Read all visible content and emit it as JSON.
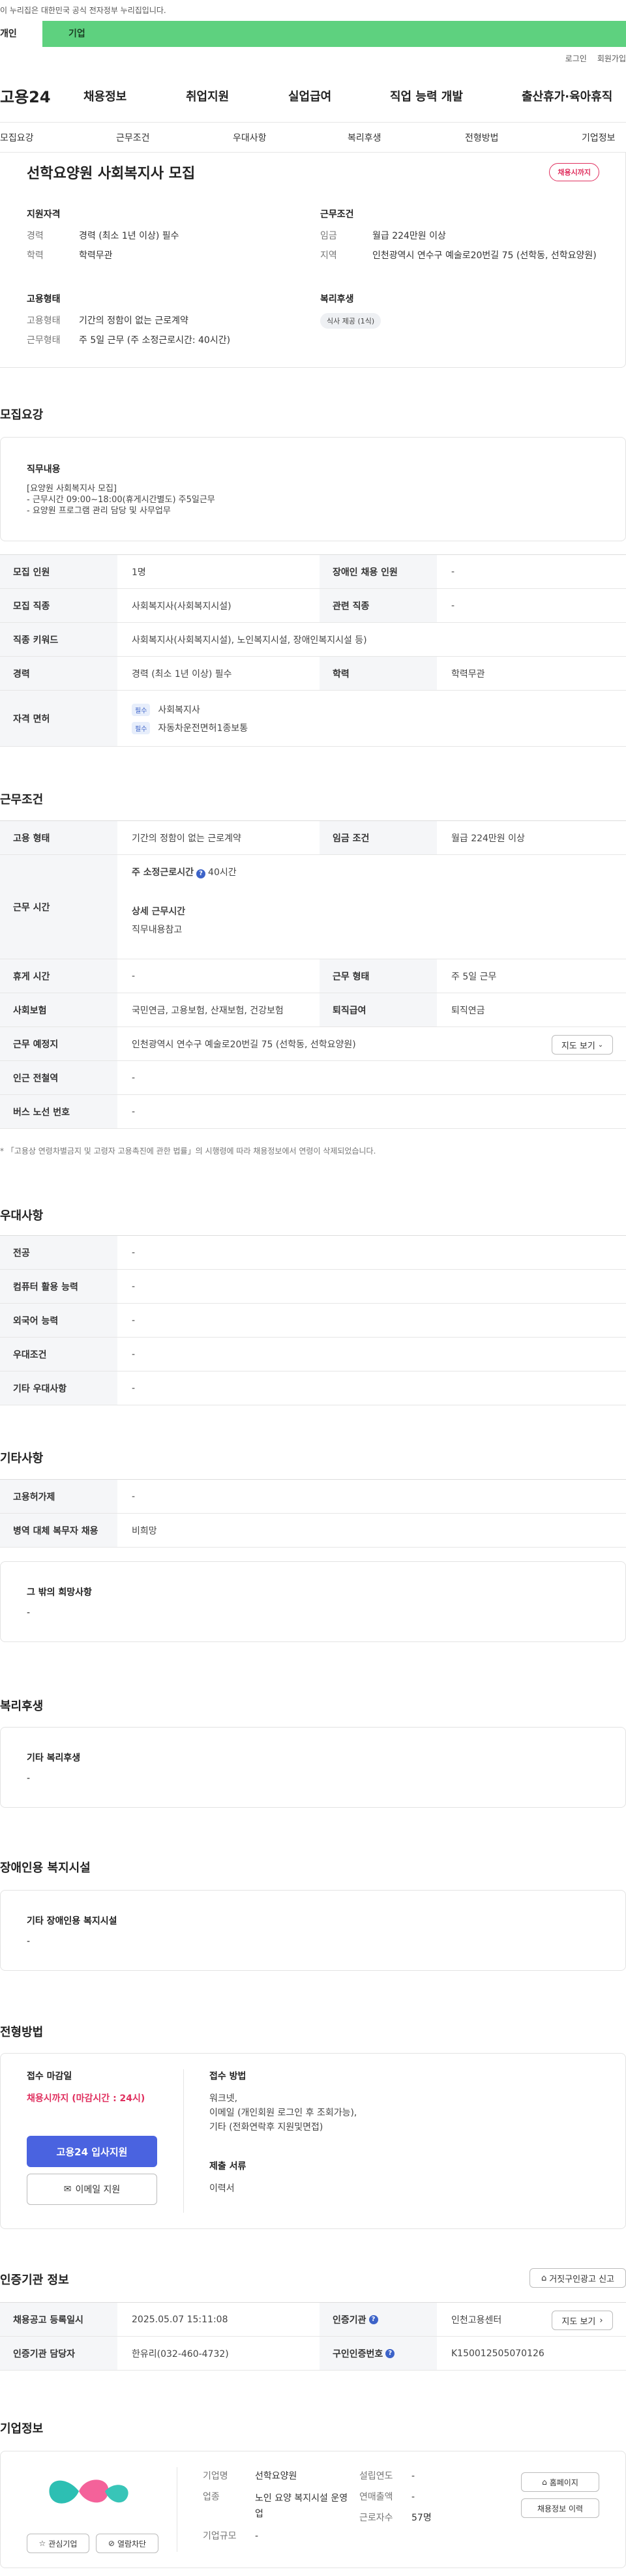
{
  "gov_banner": "이 누리집은 대한민국 공식 전자정부 누리집입니다.",
  "top_tabs": [
    "개인",
    "기업"
  ],
  "util": [
    "로그인",
    "회원가입"
  ],
  "gnb": {
    "logo": "고용24",
    "items": [
      "채용정보",
      "취업지원",
      "실업급여",
      "직업 능력 개발",
      "출산휴가·육아휴직"
    ]
  },
  "subnav": [
    "모집요강",
    "근무조건",
    "우대사항",
    "복리후생",
    "전형방법",
    "기업정보"
  ],
  "summary": {
    "title": "선학요양원 사회복지사 모집",
    "badge": "채용시까지",
    "qual_h": "지원자격",
    "qual": [
      {
        "k": "경력",
        "v": "경력 (최소 1년 이상) 필수"
      },
      {
        "k": "학력",
        "v": "학력무관"
      }
    ],
    "work_h": "근무조건",
    "work": [
      {
        "k": "임금",
        "v": "월급 224만원 이상"
      },
      {
        "k": "지역",
        "v": "인천광역시 연수구 예술로20번길 75 (선학동, 선학요양원)"
      }
    ],
    "emp_h": "고용형태",
    "emp": [
      {
        "k": "고용형태",
        "v": "기간의 정함이 없는 근로계약"
      },
      {
        "k": "근무형태",
        "v": "주 5일 근무 (주 소정근로시간: 40시간)"
      }
    ],
    "welfare_h": "복리후생",
    "welfare_chip": "식사 제공 (1식)"
  },
  "recruit": {
    "heading": "모집요강",
    "duty_h": "직무내용",
    "duty_lines": [
      "[요양원 사회복지사 모집]",
      "- 근무시간 09:00~18:00(휴게시간별도) 주5일근무",
      "- 요양원 프로그램 관리 담당 및 사무업무"
    ],
    "rows": [
      {
        "k1": "모집 인원",
        "v1": "1명",
        "k2": "장애인 채용 인원",
        "v2": "-"
      },
      {
        "k1": "모집 직종",
        "v1": "사회복지사(사회복지시설)",
        "k2": "관련 직종",
        "v2": "-"
      },
      {
        "k1": "직종 키워드",
        "v1": "사회복지사(사회복지시설), 노인복지시설, 장애인복지시설 등)"
      },
      {
        "k1": "경력",
        "v1": "경력 (최소 1년 이상) 필수",
        "k2": "학력",
        "v2": "학력무관"
      }
    ],
    "license_h": "자격 면허",
    "licenses": [
      {
        "tag": "필수",
        "name": "사회복지사"
      },
      {
        "tag": "필수",
        "name": "자동차운전면허1종보통"
      }
    ]
  },
  "conditions": {
    "heading": "근무조건",
    "emp_type_k": "고용 형태",
    "emp_type_v": "기간의 정함이 없는 근로계약",
    "wage_k": "임금 조건",
    "wage_v": "월급 224만원 이상",
    "hours_k": "근무 시간",
    "hours_h": "주 소정근로시간",
    "hours_v": "40시간",
    "detail_h": "상세 근무시간",
    "detail_v": "직무내용참고",
    "rest_k": "휴게 시간",
    "rest_v": "-",
    "form_k": "근무 형태",
    "form_v": "주 5일 근무",
    "ins_k": "사회보험",
    "ins_v": "국민연금, 고용보험, 산재보험, 건강보험",
    "ret_k": "퇴직급여",
    "ret_v": "퇴직연금",
    "place_k": "근무 예정지",
    "place_v": "인천광역시 연수구 예술로20번길 75 (선학동, 선학요양원)",
    "map_btn": "지도 보기",
    "subway_k": "인근 전철역",
    "subway_v": "-",
    "bus_k": "버스 노선 번호",
    "bus_v": "-",
    "note": "* 「고용상 연령차별금지 및 고령자 고용촉진에 관한 법률」의 시행령에 따라 채용정보에서 연령이 삭제되었습니다."
  },
  "preference": {
    "heading": "우대사항",
    "rows": [
      {
        "k": "전공",
        "v": "-"
      },
      {
        "k": "컴퓨터 활용 능력",
        "v": "-"
      },
      {
        "k": "외국어 능력",
        "v": "-"
      },
      {
        "k": "우대조건",
        "v": "-"
      },
      {
        "k": "기타 우대사항",
        "v": "-"
      }
    ]
  },
  "etc": {
    "heading": "기타사항",
    "rows": [
      {
        "k": "고용허가제",
        "v": "-"
      },
      {
        "k": "병역 대체 복무자 채용",
        "v": "비희망"
      }
    ],
    "other_h": "그 밖의 희망사항",
    "other_v": "-"
  },
  "welfare": {
    "heading": "복리후생",
    "h": "기타 복리후생",
    "v": "-"
  },
  "disabled": {
    "heading": "장애인용 복지시설",
    "h": "기타 장애인용 복지시설",
    "v": "-"
  },
  "selection": {
    "heading": "전형방법",
    "deadline_h": "접수 마감일",
    "deadline_v": "채용시까지 (마감시간 : 24시)",
    "apply_btn": "고용24 입사지원",
    "email_btn": "이메일 지원",
    "method_h": "접수 방법",
    "method_lines": [
      "워크넷,",
      "이메일 (개인회원 로그인 후 조회가능),",
      "기타 (전화연락후 지원및면접)"
    ],
    "docs_h": "제출 서류",
    "docs_v": "이력서"
  },
  "agency": {
    "heading": "인증기관 정보",
    "report_btn": "거짓구인광고 신고",
    "reg_k": "채용공고 등록일시",
    "reg_v": "2025.05.07 15:11:08",
    "agency_k": "인증기관",
    "agency_v": "인천고용센터",
    "map_btn": "지도 보기",
    "manager_k": "인증기관 담당자",
    "manager_v": "한유리(032-460-4732)",
    "auth_k": "구인인증번호",
    "auth_v": "K150012505070126"
  },
  "company": {
    "heading": "기업정보",
    "fav_btn": "관심기업",
    "block_btn": "열람차단",
    "name_k": "기업명",
    "name_v": "선학요양원",
    "ind_k": "업종",
    "ind_v": "노인 요양 복지시설 운영업",
    "size_k": "기업규모",
    "size_v": "-",
    "est_k": "설립연도",
    "est_v": "-",
    "sales_k": "연매출액",
    "sales_v": "-",
    "emp_k": "근로자수",
    "emp_v": "57명",
    "home_btn": "홈페이지",
    "history_btn": "채용정보 이력"
  }
}
